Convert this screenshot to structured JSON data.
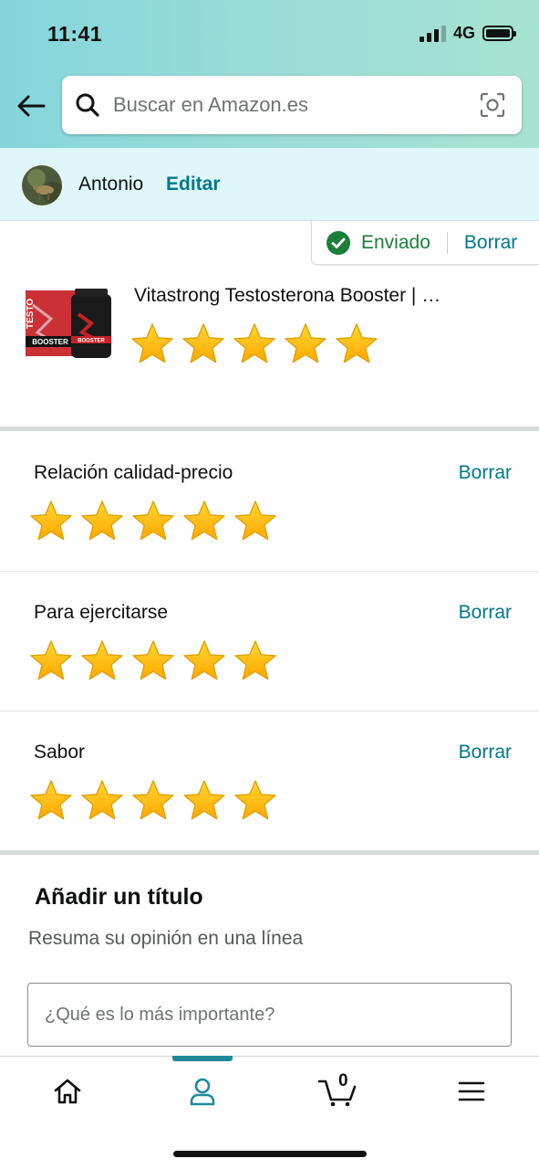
{
  "status_bar": {
    "time": "11:41",
    "network": "4G",
    "signal_bars": 3,
    "battery_level": 1.0
  },
  "header": {
    "back_icon": "arrow-left-icon",
    "search": {
      "placeholder": "Buscar en Amazon.es",
      "value": "",
      "search_icon": "magnifier-icon",
      "camera_icon": "camera-scan-icon"
    }
  },
  "user": {
    "name": "Antonio",
    "edit_label": "Editar"
  },
  "submission": {
    "status_label": "Enviado",
    "delete_label": "Borrar"
  },
  "product": {
    "title": "Vitastrong Testosterona Booster | …",
    "rating": 5,
    "max_rating": 5,
    "image_text": "TESTO BOOSTER"
  },
  "attributes": [
    {
      "label": "Relación calidad-precio",
      "delete_label": "Borrar",
      "rating": 5
    },
    {
      "label": "Para ejercitarse",
      "delete_label": "Borrar",
      "rating": 5
    },
    {
      "label": "Sabor",
      "delete_label": "Borrar",
      "rating": 5
    }
  ],
  "title_section": {
    "heading": "Añadir un título",
    "subtitle": "Resuma su opinión en una línea",
    "placeholder": "¿Qué es lo más importante?",
    "value": ""
  },
  "bottom_nav": {
    "items": [
      {
        "name": "home",
        "icon": "home-icon"
      },
      {
        "name": "account",
        "icon": "person-icon",
        "active": true
      },
      {
        "name": "cart",
        "icon": "cart-icon",
        "count": "0"
      },
      {
        "name": "menu",
        "icon": "hamburger-menu-icon"
      }
    ]
  },
  "colors": {
    "link": "#00798a",
    "success": "#1b7f3a",
    "star": "#ffb800",
    "header_gradient_start": "#84d6dc",
    "header_gradient_end": "#a6e3d0",
    "user_bar": "#dff6fb",
    "active_nav": "#1f8a9a"
  }
}
